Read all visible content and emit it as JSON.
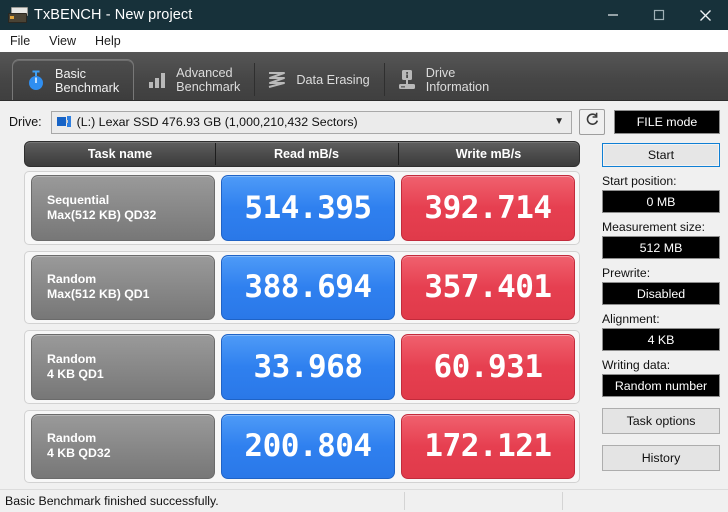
{
  "window": {
    "title": "TxBENCH - New project",
    "icon": "drive-icon",
    "minimize": "minimize-icon",
    "maximize": "maximize-icon",
    "close": "close-icon"
  },
  "menu": {
    "items": [
      {
        "label": "File"
      },
      {
        "label": "View"
      },
      {
        "label": "Help"
      }
    ]
  },
  "tabs": [
    {
      "label": "Basic\nBenchmark",
      "icon": "stopwatch-icon",
      "active": true
    },
    {
      "label": "Advanced\nBenchmark",
      "icon": "bar-chart-icon",
      "active": false
    },
    {
      "label": "Data Erasing",
      "icon": "shred-icon",
      "active": false
    },
    {
      "label": "Drive\nInformation",
      "icon": "drive-info-icon",
      "active": false
    }
  ],
  "drive": {
    "label": "Drive:",
    "value": "(L:) Lexar SSD  476.93 GB (1,000,210,432 Sectors)",
    "icon": "drive-small-icon",
    "dropdown_arrow": "chevron-down-icon",
    "refresh_icon": "refresh-icon",
    "mode_button": "FILE mode"
  },
  "table": {
    "headers": [
      "Task name",
      "Read mB/s",
      "Write mB/s"
    ],
    "rows": [
      {
        "task": "Sequential\nMax(512 KB) QD32",
        "read": "514.395",
        "write": "392.714"
      },
      {
        "task": "Random\nMax(512 KB) QD1",
        "read": "388.694",
        "write": "357.401"
      },
      {
        "task": "Random\n4 KB QD1",
        "read": "33.968",
        "write": "60.931"
      },
      {
        "task": "Random\n4 KB QD32",
        "read": "200.804",
        "write": "172.121"
      }
    ]
  },
  "panel": {
    "start_button": "Start",
    "fields": [
      {
        "label": "Start position:",
        "value": "0 MB"
      },
      {
        "label": "Measurement size:",
        "value": "512 MB"
      },
      {
        "label": "Prewrite:",
        "value": "Disabled"
      },
      {
        "label": "Alignment:",
        "value": "4 KB"
      },
      {
        "label": "Writing data:",
        "value": "Random number"
      }
    ],
    "task_options_button": "Task options",
    "history_button": "History"
  },
  "status": {
    "message": "Basic Benchmark finished successfully."
  },
  "colors": {
    "titlebar": "#17313a",
    "read": "#2f80ef",
    "write": "#e63f50",
    "accent": "#0f7fd4"
  },
  "chart_data": {
    "type": "bar",
    "title": "Basic Benchmark",
    "categories": [
      "Sequential Max(512 KB) QD32",
      "Random Max(512 KB) QD1",
      "Random 4 KB QD1",
      "Random 4 KB QD32"
    ],
    "series": [
      {
        "name": "Read mB/s",
        "values": [
          514.395,
          388.694,
          33.968,
          200.804
        ]
      },
      {
        "name": "Write mB/s",
        "values": [
          392.714,
          357.401,
          60.931,
          172.121
        ]
      }
    ],
    "xlabel": "Task name",
    "ylabel": "mB/s"
  }
}
